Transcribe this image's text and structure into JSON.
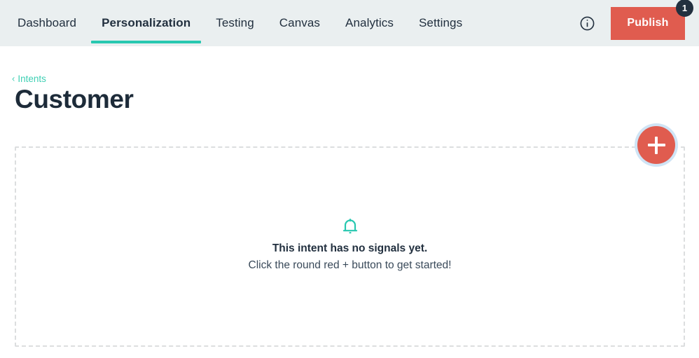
{
  "app": {
    "chrome_strip_color": "#22303f"
  },
  "header": {
    "background_color": "#eaeff0",
    "nav": [
      {
        "label": "Dashboard",
        "active": false
      },
      {
        "label": "Personalization",
        "active": true
      },
      {
        "label": "Testing",
        "active": false
      },
      {
        "label": "Canvas",
        "active": false
      },
      {
        "label": "Analytics",
        "active": false
      },
      {
        "label": "Settings",
        "active": false
      }
    ],
    "active_indicator_color": "#28c8b0",
    "info_icon": "info-circle-icon",
    "publish": {
      "label": "Publish",
      "badge_count": "1",
      "color": "#e05c4f",
      "badge_color": "#22303f"
    }
  },
  "page": {
    "breadcrumb": {
      "chevron": "‹",
      "label": "Intents",
      "color": "#3fd0b4"
    },
    "title": "Customer",
    "title_color": "#1d2b39"
  },
  "empty_state": {
    "icon": "bell-icon",
    "icon_color": "#28c8b0",
    "title": "This intent has no signals yet.",
    "subtitle": "Click the round red + button to get started!",
    "panel_border_color": "#dcdedf"
  },
  "fab": {
    "icon": "plus-icon",
    "color": "#e05c4f",
    "focus_ring_color": "#cfe4f5"
  }
}
